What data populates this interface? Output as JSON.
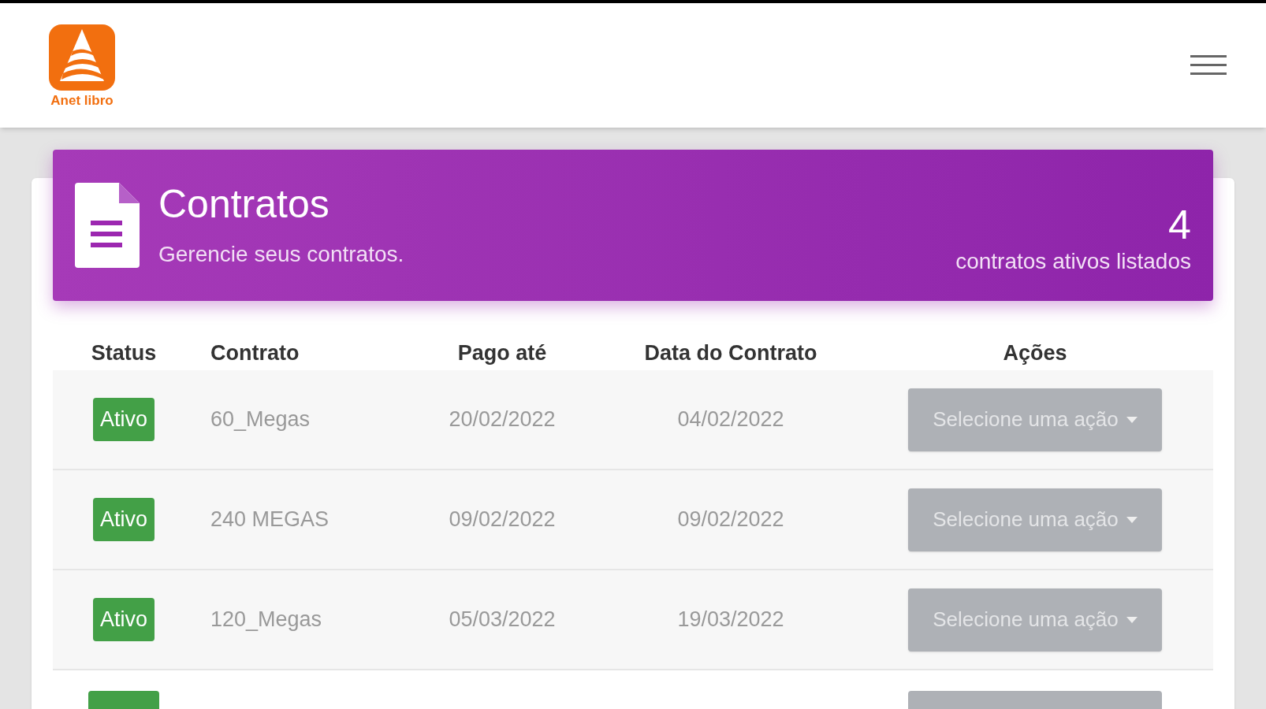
{
  "header": {
    "logo_text": "Anet libro"
  },
  "banner": {
    "title": "Contratos",
    "subtitle": "Gerencie seus contratos.",
    "count": "4",
    "count_label": "contratos ativos listados"
  },
  "table": {
    "columns": [
      "Status",
      "Contrato",
      "Pago até",
      "Data do Contrato",
      "Ações"
    ],
    "rows": [
      {
        "status": "Ativo",
        "contract": "60_Megas",
        "paid_until": "20/02/2022",
        "contract_date": "04/02/2022",
        "action": "Selecione uma ação"
      },
      {
        "status": "Ativo",
        "contract": "240 MEGAS",
        "paid_until": "09/02/2022",
        "contract_date": "09/02/2022",
        "action": "Selecione uma ação"
      },
      {
        "status": "Ativo",
        "contract": "120_Megas",
        "paid_until": "05/03/2022",
        "contract_date": "19/03/2022",
        "action": "Selecione uma ação"
      }
    ]
  }
}
